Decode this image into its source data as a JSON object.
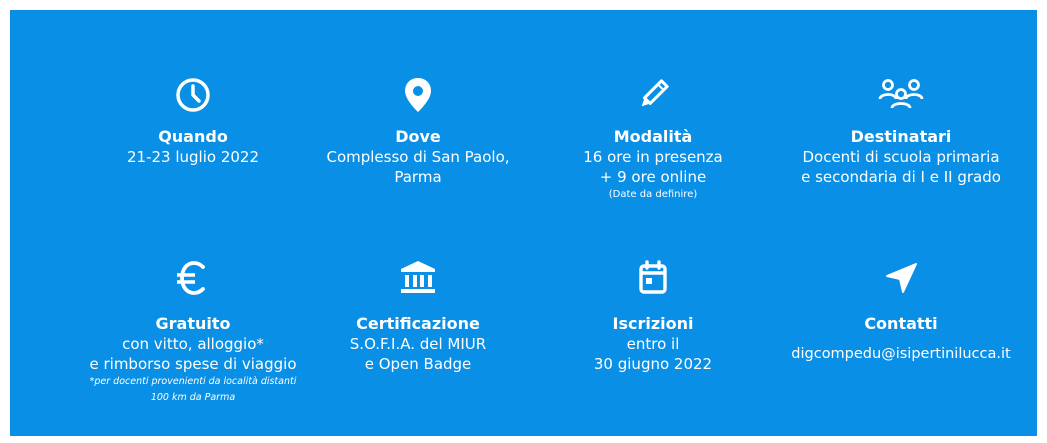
{
  "colors": {
    "background": "#0a8fe6",
    "foreground": "#ffffff"
  },
  "items": [
    {
      "icon": "clock-icon",
      "title": "Quando",
      "lines": [
        "21-23 luglio 2022"
      ]
    },
    {
      "icon": "location-pin-icon",
      "title": "Dove",
      "lines": [
        "Complesso di San Paolo,",
        "Parma"
      ]
    },
    {
      "icon": "pencil-icon",
      "title": "Modalità",
      "lines": [
        "16 ore in presenza",
        "+ 9 ore online"
      ],
      "note": "(Date da definire)"
    },
    {
      "icon": "people-icon",
      "title": "Destinatari",
      "lines": [
        "Docenti di scuola primaria",
        "e secondaria di I e II grado"
      ]
    },
    {
      "icon": "euro-icon",
      "title": "Gratuito",
      "lines": [
        "con vitto,  alloggio*",
        "e rimborso spese di viaggio"
      ],
      "notes": [
        "*per docenti provenienti da località distanti",
        "100 km da Parma"
      ]
    },
    {
      "icon": "institution-icon",
      "title": "Certificazione",
      "lines": [
        "S.O.F.I.A. del MIUR",
        "e Open Badge"
      ]
    },
    {
      "icon": "calendar-icon",
      "title": "Iscrizioni",
      "lines": [
        "entro il",
        "30 giugno 2022"
      ]
    },
    {
      "icon": "navigation-arrow-icon",
      "title": "Contatti",
      "lines": [
        "digcompedu@isipertinilucca.it"
      ]
    }
  ]
}
